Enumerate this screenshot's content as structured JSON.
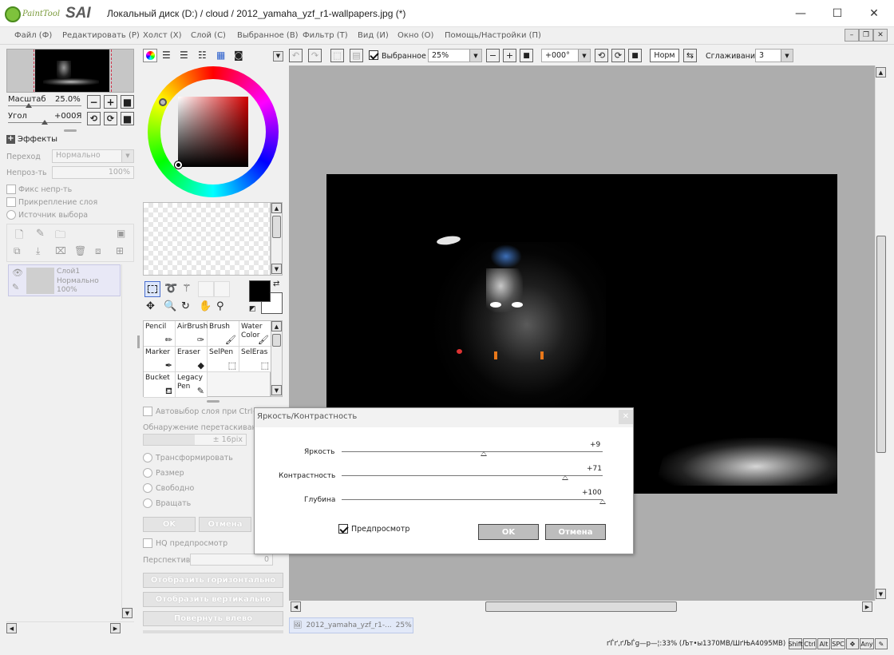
{
  "window": {
    "logo_small": "PaintTool",
    "logo_big": "SAI",
    "title": "Локальный диск (D:) / cloud / 2012_yamaha_yzf_r1-wallpapers.jpg (*)",
    "min_glyph": "—",
    "max_glyph": "☐",
    "close_glyph": "✕"
  },
  "menu": {
    "items": [
      "Файл (Ф)",
      "Редактировать (Р)",
      "Холст (Х)",
      "Слой (С)",
      "Выбранное (В)",
      "Фильтр (Т)",
      "Вид (И)",
      "Окно (О)",
      "Помощь/Настройки (П)"
    ],
    "mdi_min": "–",
    "mdi_restore": "❐",
    "mdi_close": "✕"
  },
  "navigator": {
    "zoom_label": "Масштаб",
    "zoom_value": "25.0%",
    "angle_label": "Угол",
    "angle_value": "+000Я",
    "btn_minus": "−",
    "btn_plus": "+",
    "btn_stop": "■"
  },
  "layers": {
    "effects_label": "Эффекты",
    "blend_label": "Переход",
    "blend_value": "Нормально",
    "opacity_label": "Непроз-ть",
    "opacity_value": "100%",
    "check1": "Фикс непр-ть",
    "check2": "Прикрепление слоя",
    "check3": "Источник выбора",
    "layer_name": "Слой1",
    "layer_mode": "Нормально",
    "layer_opacity": "100%"
  },
  "toolbar": {
    "selection_label": "Выбранное",
    "zoom_value": "25%",
    "angle_value": "+000°",
    "norm_label": "Норм",
    "smoothing_label": "Сглаживание",
    "smoothing_value": "3"
  },
  "tools": {
    "primary_color": "#000000",
    "secondary_color": "#ffffff",
    "cells": [
      {
        "line1": "Pencil",
        "line2": ""
      },
      {
        "line1": "AirBrush",
        "line2": ""
      },
      {
        "line1": "Brush",
        "line2": ""
      },
      {
        "line1": "Water",
        "line2": "Color"
      },
      {
        "line1": "Marker",
        "line2": ""
      },
      {
        "line1": "Eraser",
        "line2": ""
      },
      {
        "line1": "SelPen",
        "line2": ""
      },
      {
        "line1": "SelEras",
        "line2": ""
      },
      {
        "line1": "Bucket",
        "line2": ""
      },
      {
        "line1": "Legacy",
        "line2": "Pen"
      }
    ]
  },
  "transform_panel": {
    "auto_select": "Автовыбор слоя при Ctrl+Пе",
    "drag_detect": "Обнаружение перетаскивания",
    "drag_value": "± 16pix",
    "radio1": "Трансформировать",
    "radio2": "Размер",
    "radio3": "Свободно",
    "radio4": "Вращать",
    "ok": "OK",
    "cancel": "Отмена",
    "hq_preview": "HQ предпросмотр",
    "perspective_label": "Перспектива",
    "perspective_value": "0",
    "flip_h": "Отобразить горизонтально",
    "flip_v": "Отобразить вертикально",
    "rotate_left": "Повернуть влево"
  },
  "dialog": {
    "title": "Яркость/Контрастность",
    "brightness_label": "Яркость",
    "brightness_value": "+9",
    "brightness": 9,
    "contrast_label": "Контрастность",
    "contrast_value": "+71",
    "contrast": 71,
    "depth_label": "Глубина",
    "depth_value": "+100",
    "depth": 100,
    "preview_label": "Предпросмотр",
    "ok": "OK",
    "cancel": "Отмена"
  },
  "status": {
    "doc_tab": "2012_yamaha_yzf_r1-...",
    "doc_zoom": "25%",
    "memory": "ґЃґ‚ґЉЃg—р—¦:33% (Љт•ы1370MB/ШґЊА4095MB)",
    "keys": [
      "Shift",
      "Ctrl",
      "Alt",
      "SPC",
      "✥",
      "Any",
      "✎"
    ]
  }
}
